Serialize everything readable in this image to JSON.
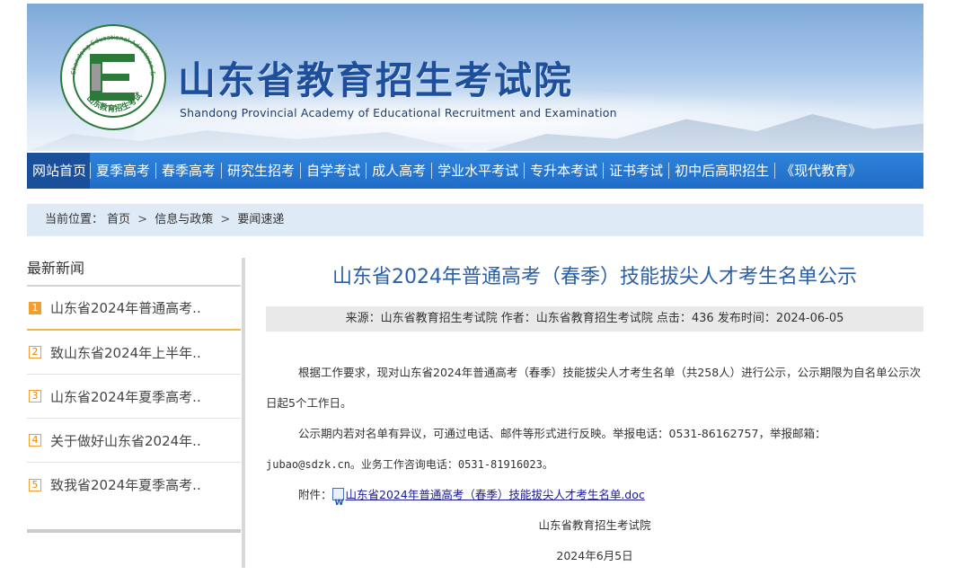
{
  "header": {
    "title": "山东省教育招生考试院",
    "subtitle": "Shandong Provincial Academy of Educational Recruitment and Examination",
    "logo_ring_text": "Shandong Educational Admission & Examinations",
    "logo_bottom_text": "山东教育招生考试"
  },
  "nav": {
    "items": [
      {
        "label": "网站首页",
        "active": true
      },
      {
        "label": "夏季高考"
      },
      {
        "label": "春季高考"
      },
      {
        "label": "研究生招考"
      },
      {
        "label": "自学考试"
      },
      {
        "label": "成人高考"
      },
      {
        "label": "学业水平考试"
      },
      {
        "label": "专升本考试"
      },
      {
        "label": "证书考试"
      },
      {
        "label": "初中后高职招生"
      },
      {
        "label": "《现代教育》"
      }
    ]
  },
  "breadcrumb": {
    "prefix": "当前位置：",
    "items": [
      "首页",
      "信息与政策",
      "要闻速递"
    ],
    "sep": ">"
  },
  "sidebar": {
    "title": "最新新闻",
    "items": [
      {
        "num": "1",
        "label": "山东省2024年普通高考.."
      },
      {
        "num": "2",
        "label": "致山东省2024年上半年.."
      },
      {
        "num": "3",
        "label": "山东省2024年夏季高考.."
      },
      {
        "num": "4",
        "label": "关于做好山东省2024年.."
      },
      {
        "num": "5",
        "label": "致我省2024年夏季高考.."
      }
    ]
  },
  "article": {
    "title": "山东省2024年普通高考（春季）技能拔尖人才考生名单公示",
    "meta": "来源：山东省教育招生考试院 作者：山东省教育招生考试院 点击：436 发布时间：2024-06-05",
    "para1": "根据工作要求，现对山东省2024年普通高考（春季）技能拔尖人才考生名单（共258人）进行公示，公示期限为自名单公示次日起5个工作日。",
    "para2_a": "公示期内若对名单有异议，可通过电话、邮件等形式进行反映。举报电话：0531-86162757，举报邮箱：",
    "para2_b": "jubao@sdzk.cn。业务工作咨询电话：0531-81916023。",
    "attach_label": "附件：",
    "attach_link": "山东省2024年普通高考（春季）技能拔尖人才考生名单.doc",
    "sign_org": "山东省教育招生考试院",
    "sign_date": "2024年6月5日"
  },
  "colors": {
    "nav_bg": "#2574d0",
    "nav_active": "#1a4f99",
    "title_blue": "#2a5fa8",
    "accent_orange": "#f0a030"
  }
}
